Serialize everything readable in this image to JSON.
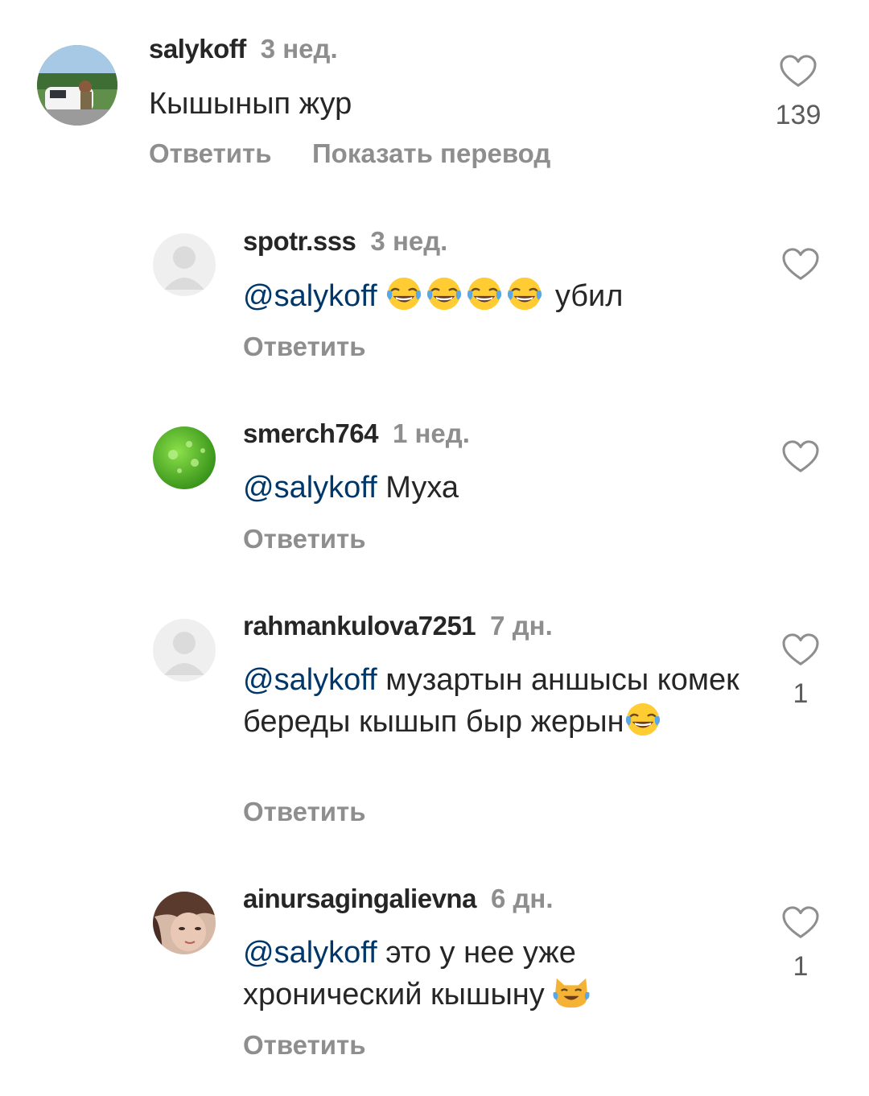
{
  "comments": [
    {
      "username": "salykoff",
      "time": "3 нед.",
      "text": "Кышынып жур",
      "likes": "139",
      "actions": {
        "reply": "Ответить",
        "translate": "Показать перевод"
      }
    },
    {
      "username": "spotr.sss",
      "time": "3 нед.",
      "mention": "@salykoff",
      "text_after_emoji": "убил",
      "emojis": [
        "face-with-tears-of-joy",
        "face-with-tears-of-joy",
        "face-with-tears-of-joy",
        "face-with-tears-of-joy"
      ],
      "reply": "Ответить"
    },
    {
      "username": "smerch764",
      "time": "1 нед.",
      "mention": "@salykoff",
      "text": "Муха",
      "reply": "Ответить"
    },
    {
      "username": "rahmankulova7251",
      "time": "7 дн.",
      "mention": "@salykoff",
      "text": "музартын аншысы комек береды кышып быр жерын",
      "emojis": [
        "face-with-tears-of-joy"
      ],
      "likes": "1",
      "reply": "Ответить"
    },
    {
      "username": "ainursagingalievna",
      "time": "6 дн.",
      "mention": "@salykoff",
      "text": "это у нее уже хронический кышыну",
      "emojis": [
        "cat-with-tears-of-joy"
      ],
      "likes": "1",
      "reply": "Ответить"
    }
  ],
  "colors": {
    "text": "#262626",
    "secondary": "#8e8e8e",
    "mention": "#00376b",
    "background": "#ffffff"
  }
}
